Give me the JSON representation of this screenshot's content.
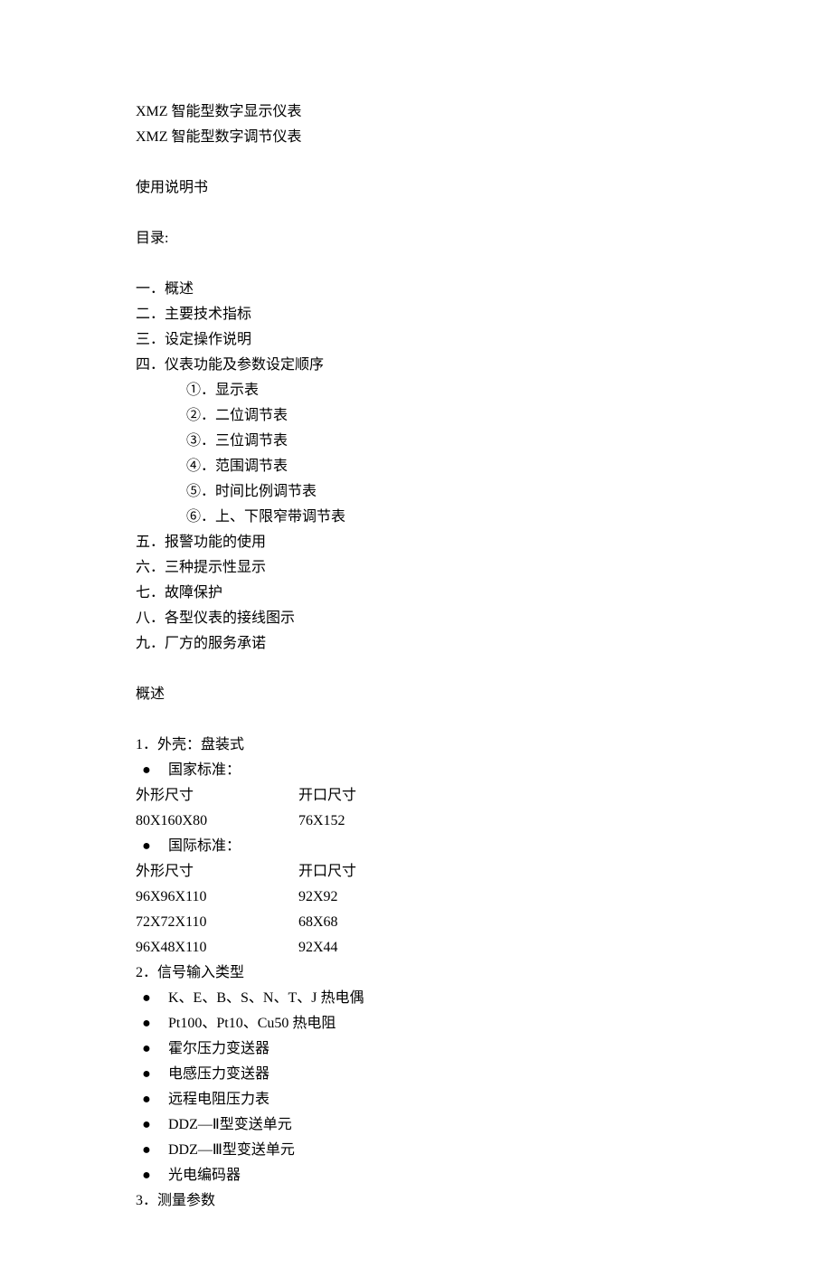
{
  "titles": {
    "t1": "XMZ 智能型数字显示仪表",
    "t2": "XMZ 智能型数字调节仪表"
  },
  "manual": "使用说明书",
  "toc_header": "目录:",
  "toc": {
    "i1": "一．概述",
    "i2": "二．主要技术指标",
    "i3": "三．设定操作说明",
    "i4": "四．仪表功能及参数设定顺序",
    "sub1": "①．显示表",
    "sub2": "②．二位调节表",
    "sub3": "③．三位调节表",
    "sub4": "④．范围调节表",
    "sub5": "⑤．时间比例调节表",
    "sub6": "⑥．上、下限窄带调节表",
    "i5": "五．报警功能的使用",
    "i6": "六．三种提示性显示",
    "i7": "七．故障保护",
    "i8": "八．各型仪表的接线图示",
    "i9": "九．厂方的服务承诺"
  },
  "overview": {
    "heading": "概述",
    "s1_label": "1．外壳：盘装式",
    "b1": "国家标准：",
    "col_header_1": "外形尺寸",
    "col_header_2": "开口尺寸",
    "gb_row1_c1": "80X160X80",
    "gb_row1_c2": "76X152",
    "b2": "国际标准：",
    "ib_row1_c1": "96X96X110",
    "ib_row1_c2": "92X92",
    "ib_row2_c1": "72X72X110",
    "ib_row2_c2": "68X68",
    "ib_row3_c1": "96X48X110",
    "ib_row3_c2": "92X44",
    "s2_label": "2．信号输入类型",
    "sig1": "K、E、B、S、N、T、J 热电偶",
    "sig2": "Pt100、Pt10、Cu50 热电阻",
    "sig3": "霍尔压力变送器",
    "sig4": "电感压力变送器",
    "sig5": "远程电阻压力表",
    "sig6": "DDZ—Ⅱ型变送单元",
    "sig7": "DDZ—Ⅲ型变送单元",
    "sig8": "光电编码器",
    "s3_label": "3．测量参数"
  }
}
